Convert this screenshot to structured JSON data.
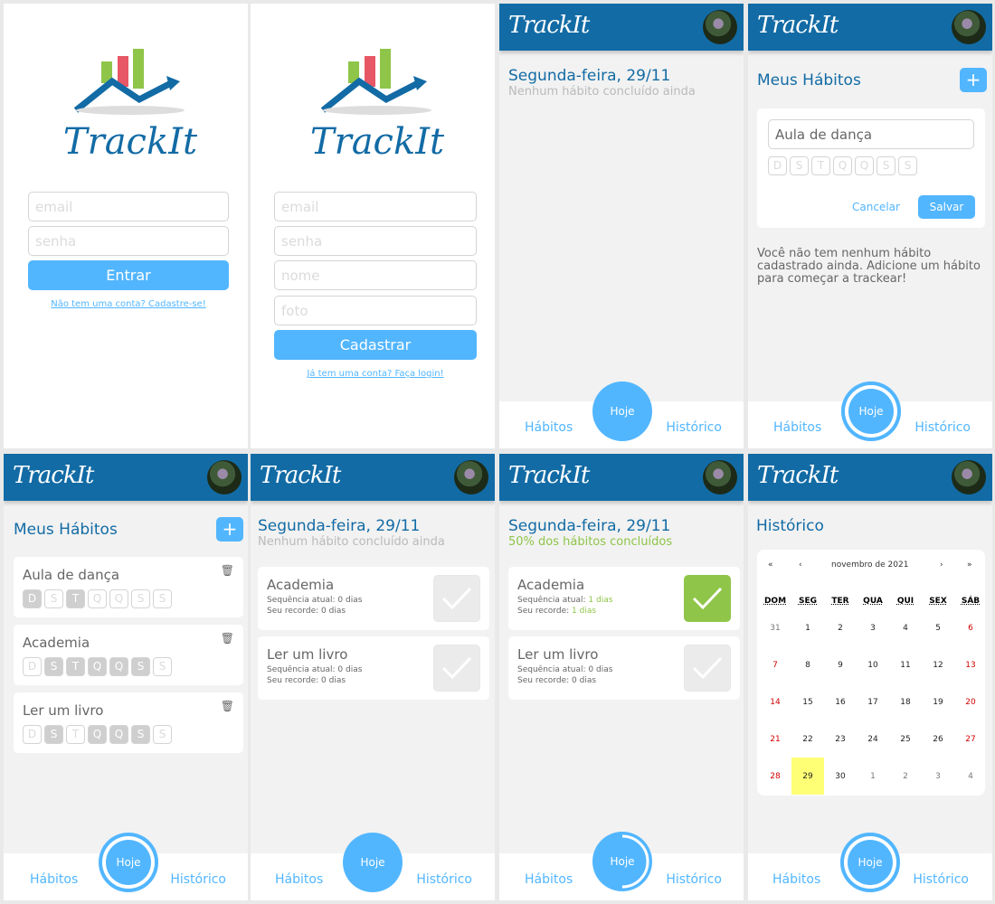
{
  "app": {
    "name": "TrackIt",
    "brand_colors": {
      "primary": "#126ba5",
      "accent": "#52b6ff",
      "green": "#8fc549"
    }
  },
  "login": {
    "email_placeholder": "email",
    "password_placeholder": "senha",
    "submit": "Entrar",
    "signup_link": "Não tem uma conta? Cadastre-se!",
    "logo_text": "TrackIt"
  },
  "signup": {
    "email_placeholder": "email",
    "password_placeholder": "senha",
    "name_placeholder": "nome",
    "photo_placeholder": "foto",
    "submit": "Cadastrar",
    "login_link": "Já tem uma conta? Faça login!",
    "logo_text": "TrackIt"
  },
  "nav": {
    "habits": "Hábitos",
    "today": "Hoje",
    "history": "Histórico"
  },
  "today_empty": {
    "date": "Segunda-feira, 29/11",
    "subtitle": "Nenhum hábito concluído ainda"
  },
  "habits_new": {
    "title": "Meus Hábitos",
    "add": "+",
    "input_value": "Aula de dança",
    "cancel": "Cancelar",
    "save": "Salvar",
    "empty_msg_1": "Você não tem nenhum hábito",
    "empty_msg_2": "cadastrado ainda. Adicione um hábito",
    "empty_msg_3": "para começar a trackear!"
  },
  "week_letters": [
    "D",
    "S",
    "T",
    "Q",
    "Q",
    "S",
    "S"
  ],
  "habits_list": {
    "title": "Meus Hábitos",
    "add": "+",
    "items": [
      {
        "name": "Aula de dança",
        "selected": [
          0,
          2
        ]
      },
      {
        "name": "Academia",
        "selected": [
          1,
          2,
          3,
          4,
          5
        ]
      },
      {
        "name": "Ler um livro",
        "selected": [
          1,
          3,
          4,
          5
        ]
      }
    ]
  },
  "today_list": {
    "date": "Segunda-feira, 29/11",
    "subtitle": "Nenhum hábito concluído ainda",
    "items": [
      {
        "name": "Academia",
        "seq_label": "Sequência atual:",
        "seq_value": "0 dias",
        "rec_label": "Seu recorde:",
        "rec_value": "0 dias"
      },
      {
        "name": "Ler um livro",
        "seq_label": "Sequência atual:",
        "seq_value": "0 dias",
        "rec_label": "Seu recorde:",
        "rec_value": "0 dias"
      }
    ]
  },
  "today_progress": {
    "date": "Segunda-feira, 29/11",
    "subtitle": "50% dos hábitos concluídos",
    "progress_fraction": 0.5,
    "items": [
      {
        "name": "Academia",
        "seq_label": "Sequência atual:",
        "seq_value": "1 dias",
        "rec_label": "Seu recorde:",
        "rec_value": "1 dias",
        "done": true
      },
      {
        "name": "Ler um livro",
        "seq_label": "Sequência atual:",
        "seq_value": "0 dias",
        "rec_label": "Seu recorde:",
        "rec_value": "0 dias",
        "done": false
      }
    ]
  },
  "history": {
    "title": "Histórico",
    "calendar": {
      "nav_prev2": "«",
      "nav_prev": "‹",
      "month": "novembro de 2021",
      "nav_next": "›",
      "nav_next2": "»",
      "weekdays": [
        "DOM",
        "SEG",
        "TER",
        "QUA",
        "QUI",
        "SEX",
        "SÁB"
      ],
      "weeks": [
        [
          "31",
          "1",
          "2",
          "3",
          "4",
          "5",
          "6"
        ],
        [
          "7",
          "8",
          "9",
          "10",
          "11",
          "12",
          "13"
        ],
        [
          "14",
          "15",
          "16",
          "17",
          "18",
          "19",
          "20"
        ],
        [
          "21",
          "22",
          "23",
          "24",
          "25",
          "26",
          "27"
        ],
        [
          "28",
          "29",
          "30",
          "1",
          "2",
          "3",
          "4"
        ]
      ],
      "highlight": "29"
    }
  }
}
